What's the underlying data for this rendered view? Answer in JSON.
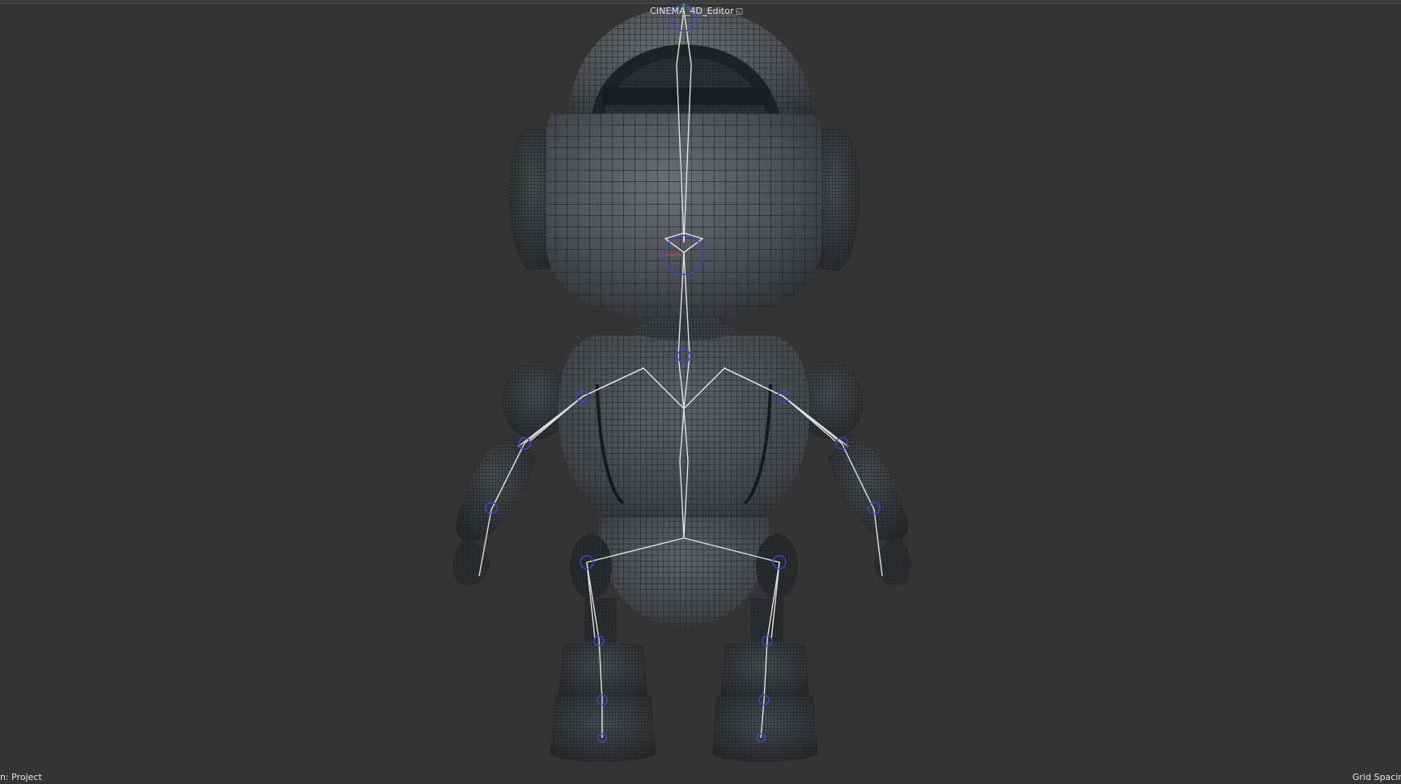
{
  "viewport": {
    "camera_name": "CINEMA_4D_Editor",
    "camera_icon": "external-camera-icon",
    "status_left": "n: Project",
    "status_right": "Grid Spacin"
  },
  "scene": {
    "object": "rigged-robot-character",
    "display_mode": "gouraud-shading-wireframe",
    "background_color": "#343434",
    "mesh_color": "#4a4e53",
    "wire_color": "#141414",
    "joint_color": "#3a44d8",
    "bone_color": "#e6e6e6"
  }
}
